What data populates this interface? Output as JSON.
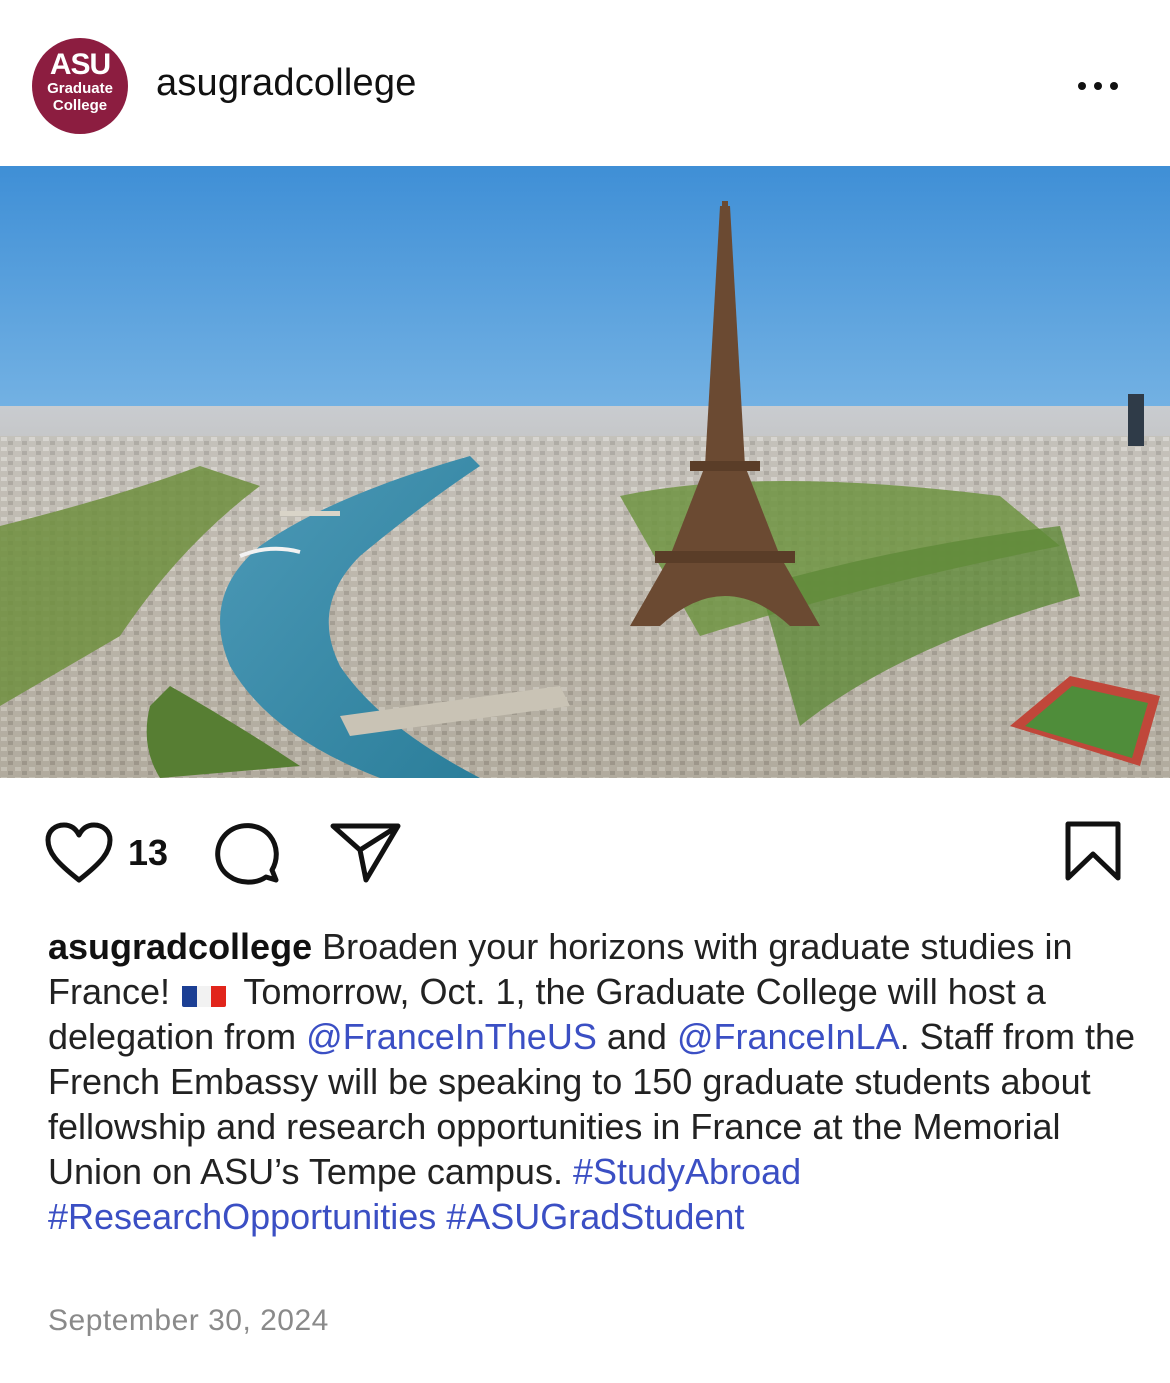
{
  "post": {
    "username": "asugradcollege",
    "avatar": {
      "line1": "ASU",
      "line2": "Graduate",
      "line3": "College",
      "color": "#8c1d40"
    },
    "like_count": "13",
    "caption": {
      "username": "asugradcollege",
      "part1": "Broaden your horizons with graduate studies in France!",
      "part2": "Tomorrow, Oct. 1, the Graduate College will host a delegation from",
      "mention1": "@FranceInTheUS",
      "part3": "and",
      "mention2": "@FranceInLA",
      "part4": ". Staff from the French Embassy will be speaking to 150 graduate students about fellowship and research opportunities in France at the Memorial Union on ASU’s Tempe campus.",
      "hashtag1": "#StudyAbroad",
      "hashtag2": "#ResearchOpportunities",
      "hashtag3": "#ASUGradStudent"
    },
    "date": "September 30, 2024",
    "link_color": "#3b4fc4",
    "icons": [
      "heart-icon",
      "comment-icon",
      "share-icon",
      "bookmark-icon",
      "more-icon",
      "france-flag-icon"
    ]
  }
}
